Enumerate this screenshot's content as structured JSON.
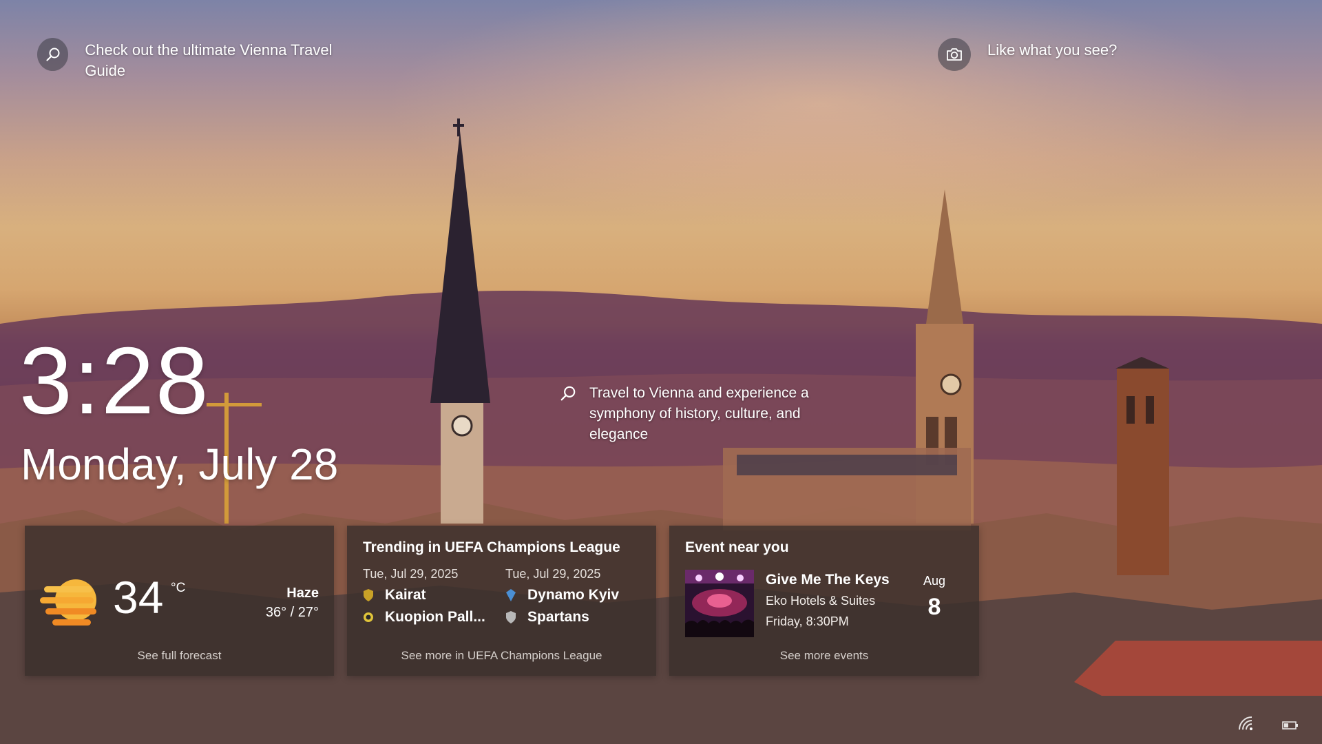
{
  "spotlight": {
    "left_text": "Check out the ultimate Vienna Travel Guide",
    "right_text": "Like what you see?",
    "mid_text": "Travel to Vienna and experience a symphony of history, culture, and elegance"
  },
  "clock": {
    "time": "3:28",
    "date": "Monday, July 28"
  },
  "weather": {
    "temperature": "34",
    "unit": "°C",
    "condition": "Haze",
    "high_low": "36° / 27°",
    "footer": "See full forecast",
    "icon": "haze-sun-icon"
  },
  "sports": {
    "title": "Trending in UEFA Champions League",
    "matches": [
      {
        "date": "Tue, Jul 29, 2025",
        "team1": "Kairat",
        "team2": "Kuopion Pall..."
      },
      {
        "date": "Tue, Jul 29, 2025",
        "team1": "Dynamo Kyiv",
        "team2": "Spartans"
      }
    ],
    "footer": "See more in UEFA Champions League"
  },
  "event": {
    "title": "Event near you",
    "name": "Give Me The Keys",
    "venue": "Eko Hotels & Suites",
    "time": "Friday, 8:30PM",
    "month": "Aug",
    "day": "8",
    "footer": "See more events"
  },
  "colors": {
    "card_bg": "#3a302c",
    "sun_yellow": "#f6b73c",
    "sun_orange": "#f08a24"
  }
}
